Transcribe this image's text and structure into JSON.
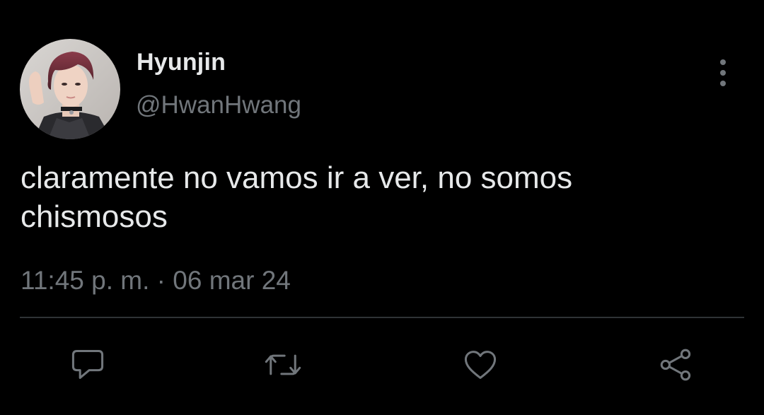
{
  "tweet": {
    "author": {
      "display_name": "Hyunjin",
      "handle": "@HwanHwang",
      "avatar_icon": "profile-photo"
    },
    "text": "claramente no vamos ir a ver, no somos chismosos",
    "meta": {
      "time": "11:45 p. m.",
      "separator": "·",
      "date": "06 mar 24"
    }
  },
  "actions": [
    {
      "name": "reply",
      "icon": "comment-bubble-icon"
    },
    {
      "name": "retweet",
      "icon": "retweet-arrows-icon"
    },
    {
      "name": "like",
      "icon": "heart-icon"
    },
    {
      "name": "share",
      "icon": "share-nodes-icon"
    }
  ],
  "colors": {
    "background": "#000000",
    "primary_text": "#e7e9ea",
    "secondary_text": "#71767b",
    "divider": "#2f3336"
  }
}
